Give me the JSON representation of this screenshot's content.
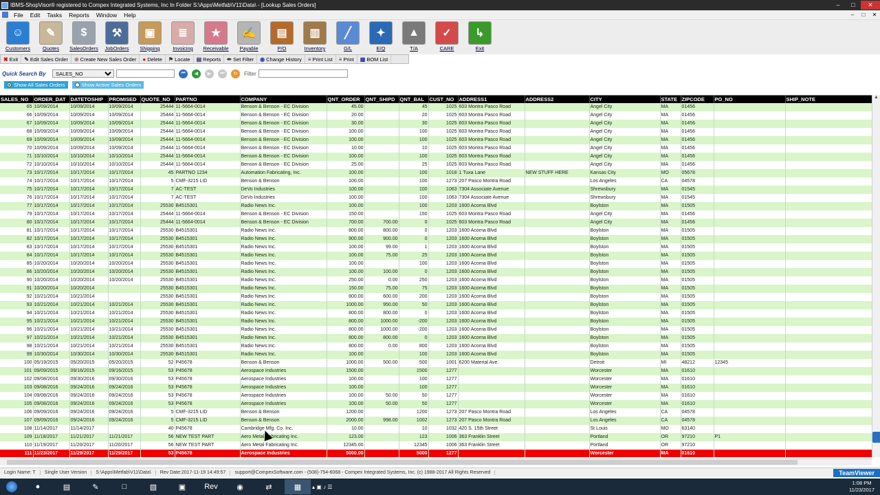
{
  "window": {
    "title": "IBMS-ShopVisor® registered to Compex Integrated Systems, Inc In Folder S:\\Apps\\Metfab\\V11\\Data\\ - [Lookup Sales Orders]",
    "minimize": "–",
    "maximize": "□",
    "close": "✕"
  },
  "menu": [
    "File",
    "Edit",
    "Tasks",
    "Reports",
    "Window",
    "Help"
  ],
  "menu_right": [
    "–",
    "□",
    "✕"
  ],
  "toolbar": [
    {
      "label": "Customers",
      "icon": "customers-icon",
      "glyph": "☺",
      "color": "#2a7fd4"
    },
    {
      "label": "Quotes",
      "icon": "quotes-icon",
      "glyph": "✎",
      "color": "#c9b79a"
    },
    {
      "label": "SalesOrders",
      "icon": "sales-orders-icon",
      "glyph": "$",
      "color": "#9aa3ad"
    },
    {
      "label": "JobOrders",
      "icon": "job-orders-icon",
      "glyph": "⚒",
      "color": "#4c6d9a"
    },
    {
      "label": "Shipping",
      "icon": "shipping-icon",
      "glyph": "▣",
      "color": "#c59a5a"
    },
    {
      "label": "Invoicing",
      "icon": "invoicing-icon",
      "glyph": "≣",
      "color": "#d8aaa8"
    },
    {
      "label": "Receivable",
      "icon": "receivable-icon",
      "glyph": "★",
      "color": "#d47a8a"
    },
    {
      "label": "Payable",
      "icon": "payable-icon",
      "glyph": "✍",
      "color": "#b5b5b5"
    },
    {
      "label": "P/O",
      "icon": "purchase-order-icon",
      "glyph": "▤",
      "color": "#b46a2a"
    },
    {
      "label": "Inventory",
      "icon": "inventory-icon",
      "glyph": "▥",
      "color": "#a07a4a"
    },
    {
      "label": "G/L",
      "icon": "general-ledger-icon",
      "glyph": "╱",
      "color": "#5a8ad4"
    },
    {
      "label": "E/Q",
      "icon": "engineering-icon",
      "glyph": "✦",
      "color": "#2a6ab4"
    },
    {
      "label": "T/A",
      "icon": "time-attendance-icon",
      "glyph": "▲",
      "color": "#7a7a7a"
    },
    {
      "label": "CARE",
      "icon": "care-icon",
      "glyph": "✓",
      "color": "#d44a4a"
    },
    {
      "label": "Exit",
      "icon": "exit-icon",
      "glyph": "↳",
      "color": "#3a9a2a"
    }
  ],
  "actions": [
    {
      "label": "Exit",
      "icon": "exit-x-icon",
      "glyph": "✖",
      "color": "#d00"
    },
    {
      "label": "Edit Sales Order",
      "icon": "edit-icon",
      "glyph": "✎",
      "color": "#333"
    },
    {
      "label": "Create New Sales Order",
      "icon": "new-icon",
      "glyph": "⊕",
      "color": "#a66"
    },
    {
      "label": "Delete",
      "icon": "delete-icon",
      "glyph": "●",
      "color": "#d00"
    },
    {
      "label": "Locate",
      "icon": "locate-icon",
      "glyph": "⚑",
      "color": "#333"
    },
    {
      "label": "Reports",
      "icon": "reports-icon",
      "glyph": "▤",
      "color": "#336"
    },
    {
      "label": "Set Filter",
      "icon": "filter-icon",
      "glyph": "✏",
      "color": "#333"
    },
    {
      "label": "Change History",
      "icon": "history-icon",
      "glyph": "◉",
      "color": "#2a4ab4"
    },
    {
      "label": "Print List",
      "icon": "print-list-icon",
      "glyph": "≡",
      "color": "#333"
    },
    {
      "label": "Print",
      "icon": "print-icon",
      "glyph": "≡",
      "color": "#333"
    },
    {
      "label": "BOM List",
      "icon": "bom-icon",
      "glyph": "▦",
      "color": "#33a"
    }
  ],
  "quick_search": {
    "label": "Quick Search By",
    "selected": "SALES_NO",
    "value": "",
    "filter_label": "Filter",
    "filter_value": ""
  },
  "radios": [
    {
      "label": "Show All Sales Orders",
      "checked": true
    },
    {
      "label": "Show Active Sales Orders",
      "checked": false
    }
  ],
  "columns": [
    "SALES_NO",
    "ORDER_DAT",
    "DATETOSHIP",
    "PROMISED",
    "QUOTE_NO",
    "PARTNO",
    "COMPANY",
    "QNT_ORDER",
    "QNT_SHIPD",
    "QNT_BAL",
    "CUST_NO",
    "ADDRESS1",
    "ADDRESS2",
    "CITY",
    "STATE",
    "ZIPCODE",
    "PO_NO",
    "SHIP_NOTE"
  ],
  "rows": [
    [
      "65",
      "10/09/2014",
      "10/09/2014",
      "10/09/2014",
      "25444",
      "11-5664-0014",
      "Benson & Benson - EC Division",
      "45.00",
      "",
      "45",
      "1025",
      "603 Montra Pasco Road",
      "",
      "Angel City",
      "MA",
      "01456",
      "",
      ""
    ],
    [
      "66",
      "10/09/2014",
      "10/09/2014",
      "10/09/2014",
      "25444",
      "11-5664-0014",
      "Benson & Benson - EC Division",
      "20.00",
      "",
      "20",
      "1025",
      "603 Montra Pasco Road",
      "",
      "Angel City",
      "MA",
      "01456",
      "",
      ""
    ],
    [
      "67",
      "10/09/2014",
      "10/09/2014",
      "10/09/2014",
      "25444",
      "11-5664-0014",
      "Benson & Benson - EC Division",
      "30.00",
      "",
      "30",
      "1025",
      "603 Montra Pasco Road",
      "",
      "Angel City",
      "MA",
      "01456",
      "",
      ""
    ],
    [
      "68",
      "10/09/2014",
      "10/09/2014",
      "10/09/2014",
      "25444",
      "11-5664-0014",
      "Benson & Benson - EC Division",
      "100.00",
      "",
      "100",
      "1025",
      "603 Montra Pasco Road",
      "",
      "Angel City",
      "MA",
      "01456",
      "",
      ""
    ],
    [
      "69",
      "10/09/2014",
      "10/09/2014",
      "10/09/2014",
      "25444",
      "11-5664-0014",
      "Benson & Benson - EC Division",
      "100.00",
      "",
      "100",
      "1025",
      "603 Montra Pasco Road",
      "",
      "Angel City",
      "MA",
      "01456",
      "",
      ""
    ],
    [
      "70",
      "10/09/2014",
      "10/09/2014",
      "10/09/2014",
      "25444",
      "11-5664-0014",
      "Benson & Benson - EC Division",
      "10.00",
      "",
      "10",
      "1025",
      "603 Montra Pasco Road",
      "",
      "Angel City",
      "MA",
      "01456",
      "",
      ""
    ],
    [
      "71",
      "10/10/2014",
      "10/10/2014",
      "10/10/2014",
      "25444",
      "11-5664-0014",
      "Benson & Benson - EC Division",
      "100.00",
      "",
      "100",
      "1025",
      "603 Montra Pasco Road",
      "",
      "Angel City",
      "MA",
      "01456",
      "",
      ""
    ],
    [
      "72",
      "10/10/2014",
      "10/10/2014",
      "10/10/2014",
      "25444",
      "11-5664-0014",
      "Benson & Benson - EC Division",
      "25.00",
      "",
      "25",
      "1025",
      "603 Montra Pasco Road",
      "",
      "Angel City",
      "MA",
      "01456",
      "",
      ""
    ],
    [
      "73",
      "10/17/2014",
      "10/17/2014",
      "10/17/2014",
      "45",
      "PARTNO 1234",
      "Automation Fabricating, Inc.",
      "100.00",
      "",
      "100",
      "1018",
      "1 Tuxa Lane",
      "NEW STUFF HERE",
      "Kansas City",
      "MO",
      "05678",
      "",
      ""
    ],
    [
      "74",
      "10/17/2014",
      "10/17/2014",
      "10/17/2014",
      "5",
      "CMF-3215 LID",
      "Benson & Benson",
      "100.00",
      "",
      "100",
      "1273",
      "207 Pasco Montra Road",
      "",
      "Los Angeles",
      "CA",
      "04578",
      "",
      ""
    ],
    [
      "75",
      "10/17/2014",
      "10/17/2014",
      "10/17/2014",
      "7",
      "AC-TEST",
      "DeVo Industries",
      "100.00",
      "",
      "100",
      "1063",
      "7304 Associate Avenue",
      "",
      "Shrewsbury",
      "MA",
      "01545",
      "",
      ""
    ],
    [
      "76",
      "10/17/2014",
      "10/17/2014",
      "10/17/2014",
      "7",
      "AC-TEST",
      "DeVo Industries",
      "100.00",
      "",
      "100",
      "1063",
      "7304 Associate Avenue",
      "",
      "Shrewsbury",
      "MA",
      "01545",
      "",
      ""
    ],
    [
      "77",
      "10/17/2014",
      "10/17/2014",
      "10/17/2014",
      "25530",
      "B4515301",
      "Radio News Inc.",
      "100.00",
      "",
      "100",
      "1203",
      "1600 Acorna Blvd",
      "",
      "Boylston",
      "MA",
      "01505",
      "",
      ""
    ],
    [
      "79",
      "10/17/2014",
      "10/17/2014",
      "10/17/2014",
      "25444",
      "11-5664-0014",
      "Benson & Benson - EC Division",
      "150.00",
      "",
      "150",
      "1025",
      "603 Montra Pasco Road",
      "",
      "Angel City",
      "MA",
      "01456",
      "",
      ""
    ],
    [
      "80",
      "10/17/2014",
      "10/17/2014",
      "10/17/2014",
      "25444",
      "11-5664-0014",
      "Benson & Benson - EC Division",
      "700.00",
      "700.00",
      "0",
      "1025",
      "603 Montra Pasco Road",
      "",
      "Angel City",
      "MA",
      "01456",
      "",
      ""
    ],
    [
      "81",
      "10/17/2014",
      "10/17/2014",
      "10/17/2014",
      "25530",
      "B4515301",
      "Radio News Inc.",
      "800.00",
      "800.00",
      "0",
      "1203",
      "1600 Acorna Blvd",
      "",
      "Boylston",
      "MA",
      "01505",
      "",
      ""
    ],
    [
      "82",
      "10/17/2014",
      "10/17/2014",
      "10/17/2014",
      "25530",
      "B4515301",
      "Radio News Inc.",
      "900.00",
      "900.00",
      "0",
      "1203",
      "1600 Acorna Blvd",
      "",
      "Boylston",
      "MA",
      "01505",
      "",
      ""
    ],
    [
      "83",
      "10/17/2014",
      "10/17/2014",
      "10/17/2014",
      "25530",
      "B4515301",
      "Radio News Inc.",
      "100.00",
      "99.00",
      "1",
      "1203",
      "1600 Acorna Blvd",
      "",
      "Boylston",
      "MA",
      "01505",
      "",
      ""
    ],
    [
      "84",
      "10/17/2014",
      "10/17/2014",
      "10/17/2014",
      "25530",
      "B4515301",
      "Radio News Inc.",
      "100.00",
      "75.00",
      "25",
      "1203",
      "1600 Acorna Blvd",
      "",
      "Boylston",
      "MA",
      "01505",
      "",
      ""
    ],
    [
      "85",
      "10/20/2014",
      "10/20/2014",
      "10/20/2014",
      "25530",
      "B4515301",
      "Radio News Inc.",
      "100.00",
      "",
      "100",
      "1203",
      "1600 Acorna Blvd",
      "",
      "Boylston",
      "MA",
      "01505",
      "",
      ""
    ],
    [
      "86",
      "10/20/2014",
      "10/20/2014",
      "10/20/2014",
      "25530",
      "B4515301",
      "Radio News Inc.",
      "100.00",
      "100.00",
      "0",
      "1203",
      "1600 Acorna Blvd",
      "",
      "Boylston",
      "MA",
      "01505",
      "",
      ""
    ],
    [
      "90",
      "10/20/2014",
      "10/20/2014",
      "10/20/2014",
      "25530",
      "B4515301",
      "Radio News Inc.",
      "250.00",
      "0.00",
      "250",
      "1203",
      "1600 Acorna Blvd",
      "",
      "Boylston",
      "MA",
      "01505",
      "",
      ""
    ],
    [
      "91",
      "10/20/2014",
      "10/20/2014",
      "",
      "25530",
      "B4515301",
      "Radio News Inc.",
      "150.00",
      "75.00",
      "75",
      "1203",
      "1600 Acorna Blvd",
      "",
      "Boylston",
      "MA",
      "01505",
      "",
      ""
    ],
    [
      "92",
      "10/21/2014",
      "10/21/2014",
      "",
      "25530",
      "B4515301",
      "Radio News Inc.",
      "800.00",
      "600.00",
      "200",
      "1203",
      "1600 Acorna Blvd",
      "",
      "Boylston",
      "MA",
      "01505",
      "",
      ""
    ],
    [
      "93",
      "10/21/2014",
      "10/21/2014",
      "10/21/2014",
      "25530",
      "B4515301",
      "Radio News Inc.",
      "1000.00",
      "950.00",
      "50",
      "1203",
      "1600 Acorna Blvd",
      "",
      "Boylston",
      "MA",
      "01505",
      "",
      ""
    ],
    [
      "94",
      "10/21/2014",
      "10/21/2014",
      "10/21/2014",
      "25530",
      "B4515301",
      "Radio News Inc.",
      "800.00",
      "800.00",
      "0",
      "1203",
      "1600 Acorna Blvd",
      "",
      "Boylston",
      "MA",
      "01505",
      "",
      ""
    ],
    [
      "95",
      "10/21/2014",
      "10/21/2014",
      "10/21/2014",
      "25530",
      "B4515301",
      "Radio News Inc.",
      "800.00",
      "1000.00",
      "-200",
      "1203",
      "1600 Acorna Blvd",
      "",
      "Boylston",
      "MA",
      "01505",
      "",
      ""
    ],
    [
      "96",
      "10/21/2014",
      "10/21/2014",
      "10/21/2014",
      "25530",
      "B4515301",
      "Radio News Inc.",
      "800.00",
      "1000.00",
      "-200",
      "1203",
      "1600 Acorna Blvd",
      "",
      "Boylston",
      "MA",
      "01505",
      "",
      ""
    ],
    [
      "97",
      "10/21/2014",
      "10/21/2014",
      "10/21/2014",
      "25530",
      "B4515301",
      "Radio News Inc.",
      "800.00",
      "800.00",
      "0",
      "1203",
      "1600 Acorna Blvd",
      "",
      "Boylston",
      "MA",
      "01505",
      "",
      ""
    ],
    [
      "98",
      "10/21/2014",
      "10/21/2014",
      "10/21/2014",
      "25530",
      "B4515301",
      "Radio News Inc.",
      "800.00",
      "0.00",
      "800",
      "1203",
      "1600 Acorna Blvd",
      "",
      "Boylston",
      "MA",
      "01505",
      "",
      ""
    ],
    [
      "99",
      "10/30/2014",
      "10/30/2014",
      "10/30/2014",
      "25530",
      "B4515301",
      "Radio News Inc.",
      "100.00",
      "",
      "100",
      "1203",
      "1600 Acorna Blvd",
      "",
      "Boylston",
      "MA",
      "01505",
      "",
      ""
    ],
    [
      "100",
      "05/19/2015",
      "05/20/2015",
      "05/20/2015",
      "52",
      "P45678",
      "Benson & Benson",
      "1000.00",
      "500.00",
      "500",
      "1001",
      "6200 Material Ave.",
      "",
      "Detroit",
      "MI",
      "48212",
      "12345",
      ""
    ],
    [
      "101",
      "09/09/2015",
      "09/16/2015",
      "09/16/2015",
      "53",
      "P45678",
      "Aerospace Industries",
      "1500.00",
      "",
      "1500",
      "1277",
      "",
      "",
      "Worcester",
      "MA",
      "01610",
      "",
      ""
    ],
    [
      "102",
      "09/08/2016",
      "09/30/2016",
      "09/30/2016",
      "53",
      "P45678",
      "Aerospace Industries",
      "100.00",
      "",
      "100",
      "1277",
      "",
      "",
      "Worcester",
      "MA",
      "01610",
      "",
      ""
    ],
    [
      "103",
      "09/08/2016",
      "09/24/2016",
      "09/24/2016",
      "53",
      "P45678",
      "Aerospace Industries",
      "100.00",
      "",
      "100",
      "1277",
      "",
      "",
      "Worcester",
      "MA",
      "01610",
      "",
      ""
    ],
    [
      "104",
      "09/08/2016",
      "09/24/2016",
      "09/24/2016",
      "53",
      "P45678",
      "Aerospace Industries",
      "100.00",
      "50.00",
      "50",
      "1277",
      "",
      "",
      "Worcester",
      "MA",
      "01610",
      "",
      ""
    ],
    [
      "105",
      "09/08/2016",
      "09/24/2016",
      "09/24/2016",
      "53",
      "P45678",
      "Aerospace Industries",
      "100.00",
      "50.00",
      "50",
      "1277",
      "",
      "",
      "Worcester",
      "MA",
      "01610",
      "",
      ""
    ],
    [
      "106",
      "09/09/2016",
      "09/24/2016",
      "09/24/2016",
      "5",
      "CMF-3215 LID",
      "Benson & Benson",
      "1200.00",
      "",
      "1200",
      "1273",
      "207 Pasco Montra Road",
      "",
      "Los Angeles",
      "CA",
      "04578",
      "",
      ""
    ],
    [
      "107",
      "09/09/2016",
      "09/24/2016",
      "09/24/2016",
      "5",
      "CMF-3215 LID",
      "Benson & Benson",
      "2000.00",
      "998.00",
      "1002",
      "1273",
      "207 Pasco Montra Road",
      "",
      "Los Angeles",
      "CA",
      "04578",
      "",
      ""
    ],
    [
      "108",
      "11/14/2017",
      "11/14/2017",
      "",
      "40",
      "P45678",
      "Cambridge Mfg. Co. Inc.",
      "10.00",
      "",
      "10",
      "1032",
      "420 S. 15th Street",
      "",
      "St Louis",
      "MO",
      "63140",
      "",
      ""
    ],
    [
      "109",
      "11/18/2017",
      "11/21/2017",
      "11/21/2017",
      "56",
      "NEW TEST PART",
      "Aero Metal Fabricating Inc.",
      "123.00",
      "",
      "123",
      "1006",
      "363 Franklin Street",
      "",
      "Portland",
      "OR",
      "97210",
      "P1",
      ""
    ],
    [
      "110",
      "11/19/2017",
      "11/20/2017",
      "11/20/2017",
      "56",
      "NEW TEST PART",
      "Aero Metal Fabricating Inc.",
      "12345.00",
      "",
      "12345",
      "1006",
      "363 Franklin Street",
      "",
      "Portland",
      "OR",
      "97210",
      "",
      ""
    ],
    [
      "111",
      "11/23/2017",
      "11/29/2017",
      "11/29/2017",
      "53",
      "P45678",
      "Aerospace Industries",
      "5000.00",
      "",
      "5000",
      "1277",
      "",
      "",
      "Worcester",
      "MA",
      "01610",
      "",
      ""
    ]
  ],
  "selected_row_index": 42,
  "status": [
    "Login Name: T",
    "Single User Version",
    "S:\\Apps\\Metfab\\V11\\Data\\",
    "Rev Date:2017-11-19 14:49:57",
    "support@CompexSoftware.com - (508)-754-6068 - Compex Integrated Systems, Inc. (c) 1988-2017 All Rights Reserved"
  ],
  "teamviewer": "TeamViewer",
  "taskbar": {
    "apps": [
      {
        "icon": "chrome-icon",
        "glyph": "●"
      },
      {
        "icon": "explorer-icon",
        "glyph": "▤"
      },
      {
        "icon": "notepad-icon",
        "glyph": "✎"
      },
      {
        "icon": "document-icon",
        "glyph": "□"
      },
      {
        "icon": "pdf-icon",
        "glyph": "▧"
      },
      {
        "icon": "monitor-icon",
        "glyph": "▣"
      },
      {
        "icon": "rev-icon",
        "glyph": "Rev"
      },
      {
        "icon": "red-app-icon",
        "glyph": "◉"
      },
      {
        "icon": "blue-app-icon",
        "glyph": "⇄"
      },
      {
        "icon": "shopvisor-icon",
        "glyph": "▦"
      }
    ],
    "tray": "▴ ▣ ♪ ☰",
    "time": "1:08 PM",
    "date": "11/23/2017"
  },
  "colors": {
    "row_alt": "#d9f5c9",
    "selected": "#f20000",
    "header": "#000000",
    "accent": "#2aa3d9"
  }
}
